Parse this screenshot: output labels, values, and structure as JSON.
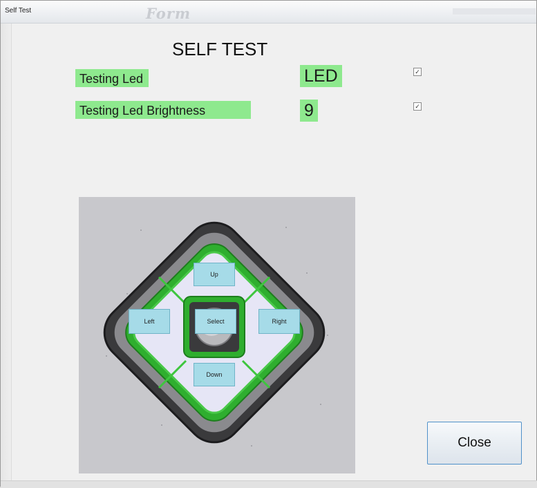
{
  "window": {
    "title": "Self Test",
    "background_brand_text": "Form"
  },
  "main": {
    "heading": "SELF TEST",
    "rows": [
      {
        "label": "Testing Led",
        "value": "LED",
        "checked": true
      },
      {
        "label": "Testing Led Brightness",
        "value": "9",
        "checked": true
      }
    ],
    "checkmark_glyph": "✓"
  },
  "pad": {
    "buttons": {
      "up": "Up",
      "left": "Left",
      "select": "Select",
      "right": "Right",
      "down": "Down"
    }
  },
  "footer": {
    "close_label": "Close"
  },
  "colors": {
    "label_highlight": "#8ee98e",
    "pad_button": "#a6dbe8",
    "pad_ring": "#3ec63e",
    "panel_bg": "#c8c8cc",
    "close_border": "#4f90c9"
  },
  "icons": [
    "checkbox-checked-icon"
  ]
}
